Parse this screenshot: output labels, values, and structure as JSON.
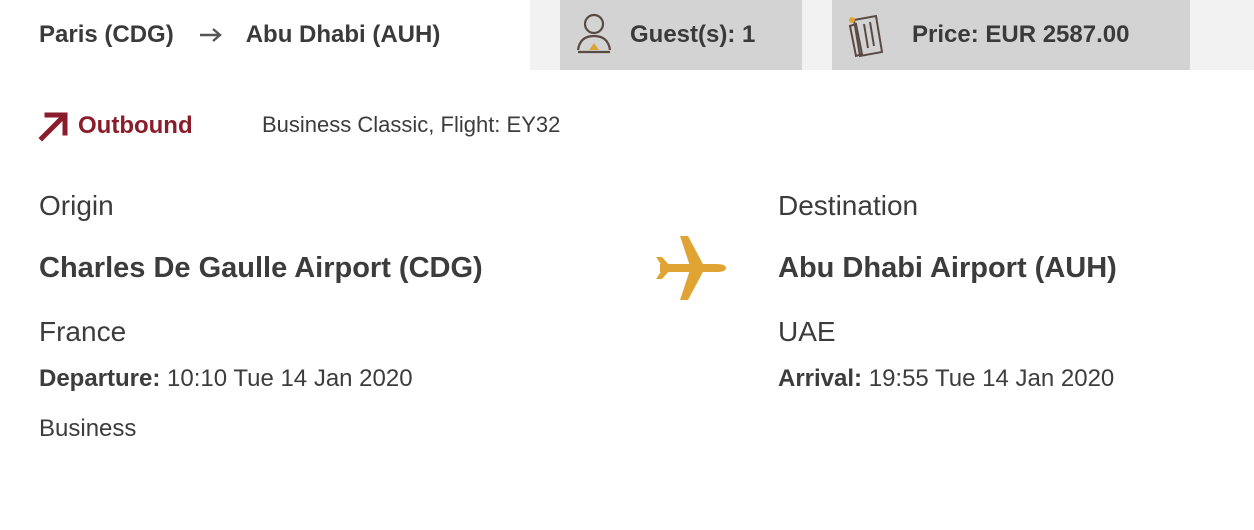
{
  "header": {
    "origin_city": "Paris (CDG)",
    "destination_city": "Abu Dhabi (AUH)",
    "route_arrow_icon": "arrow-right-icon",
    "guests_label": "Guest(s): 1",
    "guests_icon": "person-icon",
    "price_label": "Price: EUR 2587.00",
    "price_icon": "receipt-icon"
  },
  "segment": {
    "direction_label": "Outbound",
    "direction_icon": "arrow-up-right-icon",
    "flight_info": "Business Classic, Flight: EY32"
  },
  "origin": {
    "heading": "Origin",
    "airport": "Charles De Gaulle Airport (CDG)",
    "country": "France",
    "time_label": "Departure:",
    "time_value": " 10:10 Tue 14 Jan 2020",
    "cabin": "Business"
  },
  "destination": {
    "heading": "Destination",
    "airport": "Abu Dhabi Airport (AUH)",
    "country": "UAE",
    "time_label": "Arrival:",
    "time_value": " 19:55 Tue 14 Jan 2020"
  },
  "colors": {
    "accent": "#8b1c2b",
    "plane": "#e0a435",
    "pill_bg": "#d3d3d3",
    "bar_bg": "#f2f2f2",
    "text": "#3c3c3c"
  }
}
